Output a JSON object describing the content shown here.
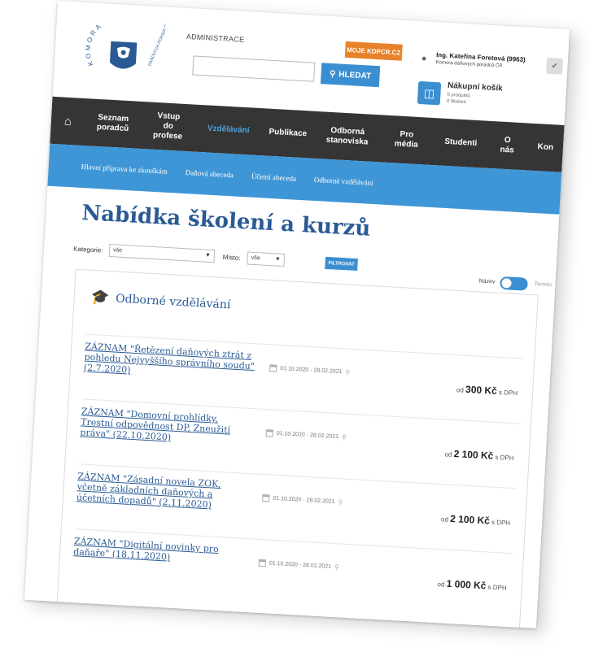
{
  "logo": {
    "arc_top": "KOMORA",
    "arc_right": "DAŇOVÝCH PORADCŮ ČR"
  },
  "header": {
    "admin_link": "ADMINISTRACE",
    "search_placeholder": "",
    "search_button": "HLEDAT",
    "moje_button": "MOJE KDPCR.CZ",
    "user_name": "Ing. Kateřina Foretová (9963)",
    "user_org": "Komora daňových poradců ČR",
    "cart_title": "Nákupní košík",
    "cart_products": "0 produktů",
    "cart_trainings": "0 školení"
  },
  "main_nav": [
    {
      "label": "Seznam\nporadců",
      "active": false
    },
    {
      "label": "Vstup\ndo profese",
      "active": false
    },
    {
      "label": "Vzdělávání",
      "active": true
    },
    {
      "label": "Publikace",
      "active": false
    },
    {
      "label": "Odborná\nstanoviska",
      "active": false
    },
    {
      "label": "Pro média",
      "active": false
    },
    {
      "label": "Studenti",
      "active": false
    },
    {
      "label": "O nás",
      "active": false
    },
    {
      "label": "Kon",
      "active": false
    }
  ],
  "sub_nav": [
    "Hlavní příprava ke zkouškám",
    "Daňová abeceda",
    "Účetní abeceda",
    "Odborné vzdělávání"
  ],
  "page": {
    "title": "Nabídka školení a kurzů",
    "filter": {
      "category_label": "Kategorie:",
      "category_value": "vše",
      "place_label": "Místo:",
      "place_value": "vše",
      "filter_button": "FILTROVAT",
      "sort_left": "Název",
      "sort_right": "Termín"
    },
    "section_title": "Odborné vzdělávání",
    "courses": [
      {
        "title": "ZÁZNAM \"Řetězení daňových ztrát z pohledu Nejvyššího správního soudu\" (2.7.2020)",
        "date": "01.10.2020 - 28.02.2021",
        "price_prefix": "od",
        "price": "300 Kč",
        "price_suffix": "s DPH"
      },
      {
        "title": "ZÁZNAM \"Domovní prohlídky, Trestní odpovědnost DP, Zneužití práva\" (22.10.2020)",
        "date": "01.10.2020 - 28.02.2021",
        "price_prefix": "od",
        "price": "2 100 Kč",
        "price_suffix": "s DPH"
      },
      {
        "title": "ZÁZNAM \"Zásadní novela ZOK, včetně základních daňových a účetních dopadů\" (2.11.2020)",
        "date": "01.10.2020 - 28.02.2021",
        "price_prefix": "od",
        "price": "2 100 Kč",
        "price_suffix": "s DPH"
      },
      {
        "title": "ZÁZNAM \"Digitální novinky pro daňaře\" (18.11.2020)",
        "date": "01.10.2020 - 28.02.2021",
        "price_prefix": "od",
        "price": "1 000 Kč",
        "price_suffix": "s DPH"
      }
    ]
  }
}
